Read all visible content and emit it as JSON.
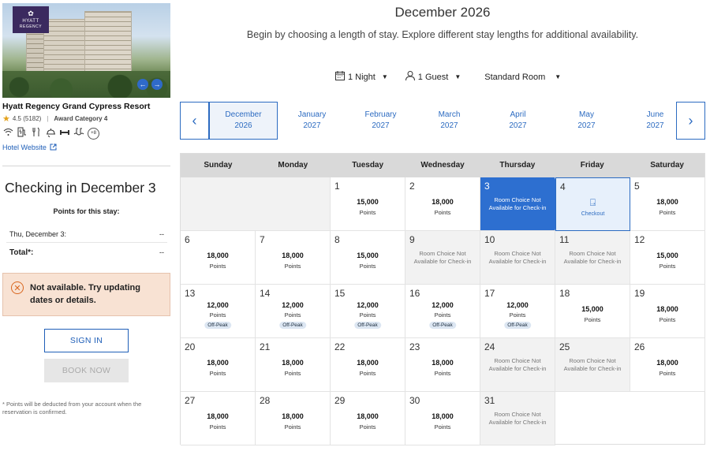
{
  "hotel": {
    "logo_line1": "HYATT",
    "logo_line2": "REGENCY",
    "name": "Hyatt Regency Grand Cypress Resort",
    "rating": "4.5 (5182)",
    "award_category": "Award Category 4",
    "amenity_more": "+8",
    "website_label": "Hotel Website"
  },
  "stay": {
    "checking_in_title": "Checking in December 3",
    "points_header": "Points for this stay:",
    "rows": [
      {
        "label": "Thu, December 3:",
        "value": "--"
      },
      {
        "label": "Total*:",
        "value": "--"
      }
    ],
    "warning": "Not available. Try updating dates or details.",
    "sign_in": "SIGN IN",
    "book_now": "BOOK NOW",
    "footnote": "* Points will be deducted from your account when the reservation is confirmed."
  },
  "header": {
    "title": "December 2026",
    "subtitle": "Begin by choosing a length of stay. Explore different stay lengths for additional availability."
  },
  "filters": {
    "nights": "1 Night",
    "guests": "1 Guest",
    "room": "Standard Room"
  },
  "months": [
    {
      "name": "December",
      "year": "2026",
      "selected": true
    },
    {
      "name": "January",
      "year": "2027"
    },
    {
      "name": "February",
      "year": "2027"
    },
    {
      "name": "March",
      "year": "2027"
    },
    {
      "name": "April",
      "year": "2027"
    },
    {
      "name": "May",
      "year": "2027"
    },
    {
      "name": "June",
      "year": "2027"
    }
  ],
  "weekdays": [
    "Sunday",
    "Monday",
    "Tuesday",
    "Wednesday",
    "Thursday",
    "Friday",
    "Saturday"
  ],
  "labels": {
    "points": "Points",
    "off_peak": "Off-Peak",
    "not_available": "Room Choice Not Available for Check-in",
    "checkout": "Checkout"
  },
  "days": [
    {
      "d": "1",
      "points": "15,000"
    },
    {
      "d": "2",
      "points": "18,000"
    },
    {
      "d": "3",
      "status": "checkin"
    },
    {
      "d": "4",
      "status": "checkout"
    },
    {
      "d": "5",
      "points": "18,000"
    },
    {
      "d": "6",
      "points": "18,000"
    },
    {
      "d": "7",
      "points": "18,000"
    },
    {
      "d": "8",
      "points": "15,000"
    },
    {
      "d": "9",
      "status": "na"
    },
    {
      "d": "10",
      "status": "na"
    },
    {
      "d": "11",
      "status": "na"
    },
    {
      "d": "12",
      "points": "15,000"
    },
    {
      "d": "13",
      "points": "12,000",
      "offpeak": true
    },
    {
      "d": "14",
      "points": "12,000",
      "offpeak": true
    },
    {
      "d": "15",
      "points": "12,000",
      "offpeak": true
    },
    {
      "d": "16",
      "points": "12,000",
      "offpeak": true
    },
    {
      "d": "17",
      "points": "12,000",
      "offpeak": true
    },
    {
      "d": "18",
      "points": "15,000"
    },
    {
      "d": "19",
      "points": "18,000"
    },
    {
      "d": "20",
      "points": "18,000"
    },
    {
      "d": "21",
      "points": "18,000"
    },
    {
      "d": "22",
      "points": "18,000"
    },
    {
      "d": "23",
      "points": "18,000"
    },
    {
      "d": "24",
      "status": "na"
    },
    {
      "d": "25",
      "status": "na"
    },
    {
      "d": "26",
      "points": "18,000"
    },
    {
      "d": "27",
      "points": "18,000"
    },
    {
      "d": "28",
      "points": "18,000"
    },
    {
      "d": "29",
      "points": "18,000"
    },
    {
      "d": "30",
      "points": "18,000"
    },
    {
      "d": "31",
      "status": "na"
    }
  ],
  "colors": {
    "accent": "#2c6bc1",
    "checkin": "#2d6fd0",
    "warning_bg": "#f8e2d3",
    "warning_icon": "#d9661f"
  }
}
